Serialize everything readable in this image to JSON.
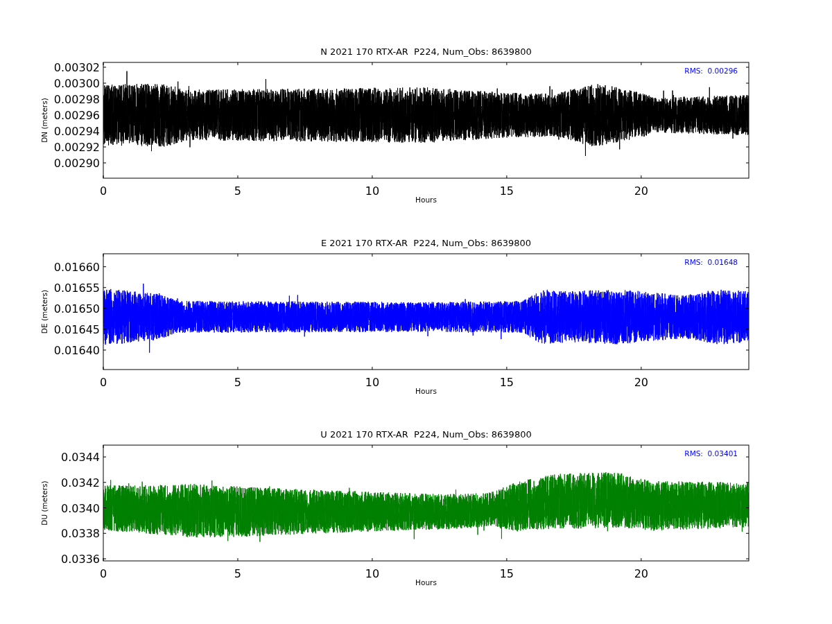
{
  "figure": {
    "panels": [
      {
        "title": "N 2021 170 RTX-AR  P224, Num_Obs: 8639800",
        "ylabel": "DN (meters)",
        "xlabel": "Hours",
        "rms": "RMS:  0.00296",
        "color": "#000000",
        "yticks": [
          "0.00302",
          "0.00300",
          "0.00298",
          "0.00296",
          "0.00294",
          "0.00292",
          "0.00290"
        ],
        "xticks": [
          "0",
          "5",
          "10",
          "15",
          "20"
        ]
      },
      {
        "title": "E 2021 170 RTX-AR  P224, Num_Obs: 8639800",
        "ylabel": "DE (meters)",
        "xlabel": "Hours",
        "rms": "RMS:  0.01648",
        "color": "#0000ff",
        "yticks": [
          "0.01660",
          "0.01655",
          "0.01650",
          "0.01645",
          "0.01640"
        ],
        "xticks": [
          "0",
          "5",
          "10",
          "15",
          "20"
        ]
      },
      {
        "title": "U 2021 170 RTX-AR  P224, Num_Obs: 8639800",
        "ylabel": "DU (meters)",
        "xlabel": "Hours",
        "rms": "RMS:  0.03401",
        "color": "#008000",
        "yticks": [
          "0.0344",
          "0.0342",
          "0.0340",
          "0.0338",
          "0.0336"
        ],
        "xticks": [
          "0",
          "5",
          "10",
          "15",
          "20"
        ]
      }
    ]
  }
}
